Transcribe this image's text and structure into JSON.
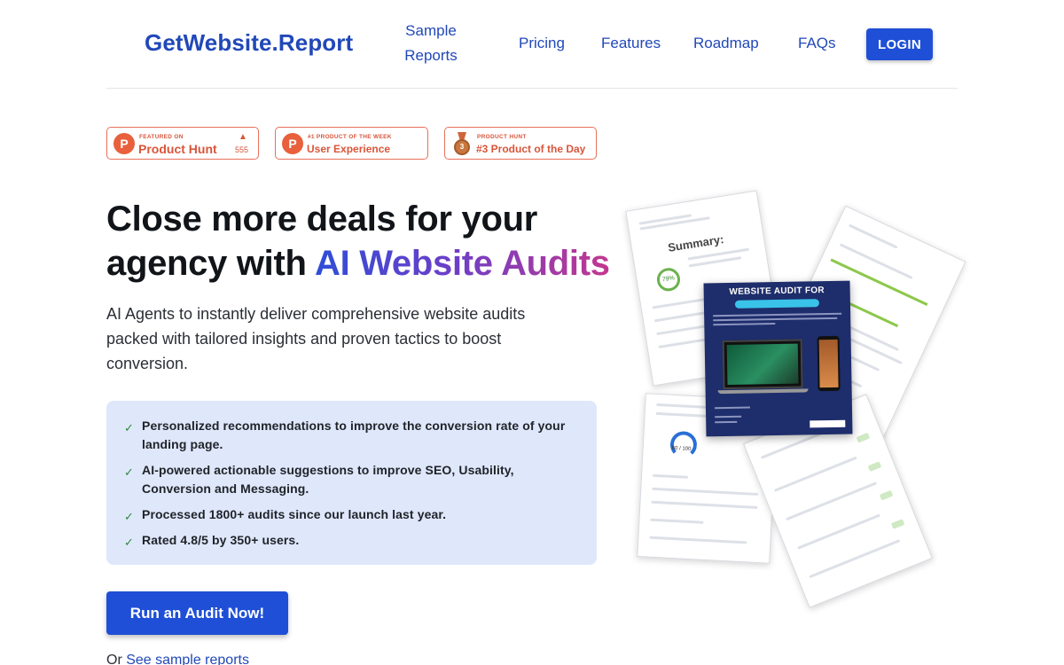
{
  "header": {
    "brand": "GetWebsite.Report",
    "nav": {
      "sample_reports_line1": "Sample",
      "sample_reports_line2": "Reports",
      "pricing": "Pricing",
      "features": "Features",
      "roadmap": "Roadmap",
      "faqs": "FAQs"
    },
    "login_label": "LOGIN"
  },
  "badges": [
    {
      "kicker": "FEATURED ON",
      "title": "Product Hunt",
      "count": "555",
      "icon": "product-hunt-icon"
    },
    {
      "kicker": "#1 PRODUCT OF THE WEEK",
      "title": "User Experience",
      "icon": "product-hunt-icon"
    },
    {
      "kicker": "PRODUCT HUNT",
      "title": "#3 Product of the Day",
      "icon": "medal-icon"
    }
  ],
  "hero": {
    "headline_plain": "Close more deals for your agency with ",
    "headline_highlight": "AI Website Audits",
    "subtext": "AI Agents to instantly deliver comprehensive website audits packed with tailored insights and proven tactics to boost conversion."
  },
  "features": [
    "Personalized recommendations to improve the conversion rate of your landing page.",
    "AI-powered actionable suggestions to improve SEO, Usability, Conversion and Messaging.",
    "Processed 1800+ audits since our launch last year.",
    "Rated 4.8/5 by 350+ users."
  ],
  "cta": {
    "label": "Run an Audit Now!",
    "or_prefix": "Or",
    "sample_link": "See sample reports"
  },
  "collage": {
    "hero_title": "WEBSITE AUDIT FOR",
    "summary_label": "Summary:",
    "score_ring": "79%",
    "gauge_value": "60 / 100"
  },
  "colors": {
    "brand_blue": "#2148b8",
    "button_blue": "#1f4fd6",
    "feature_bg": "#dfe7fb",
    "badge_orange": "#e8603c",
    "check_green": "#2e8a3e"
  }
}
